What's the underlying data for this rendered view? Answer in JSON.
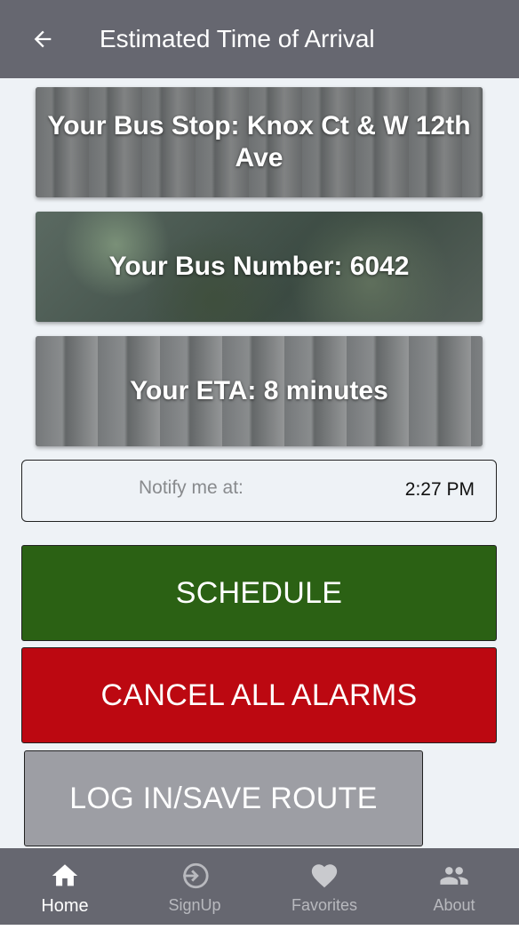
{
  "header": {
    "title": "Estimated Time of Arrival",
    "back_icon": "arrow-left-icon"
  },
  "cards": {
    "stop": "Your Bus Stop: Knox Ct & W 12th Ave",
    "number": "Your Bus Number: 6042",
    "eta": "Your ETA: 8 minutes"
  },
  "notify": {
    "label": "Notify me at:",
    "time": "2:27 PM"
  },
  "buttons": {
    "schedule": "SCHEDULE",
    "cancel": "CANCEL ALL ALARMS",
    "login": "LOG IN/SAVE ROUTE"
  },
  "nav": {
    "items": [
      {
        "label": "Home",
        "icon": "home-icon",
        "active": true
      },
      {
        "label": "SignUp",
        "icon": "sign-in-icon",
        "active": false
      },
      {
        "label": "Favorites",
        "icon": "heart-icon",
        "active": false
      },
      {
        "label": "About",
        "icon": "people-icon",
        "active": false
      }
    ]
  },
  "colors": {
    "appbar": "#666770",
    "background": "#eef2f6",
    "schedule": "#2b6114",
    "cancel": "#bc0811",
    "login": "#9d9ea4"
  }
}
